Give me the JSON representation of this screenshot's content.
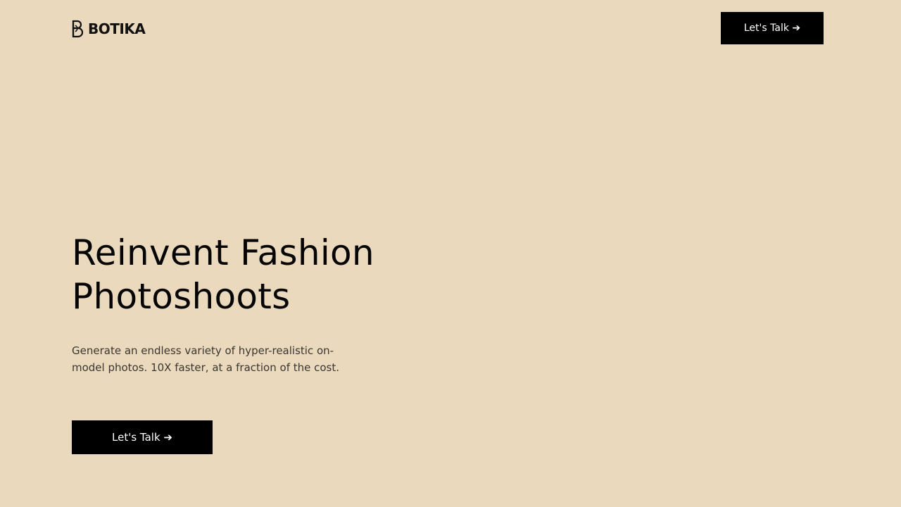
{
  "header": {
    "brand": "BOTIKA",
    "logo_icon": "botika-b-logo-icon",
    "cta_label": "Let's Talk ➔"
  },
  "hero": {
    "title_line1": "Reinvent Fashion",
    "title_line2": "Photoshoots",
    "subtitle": "Generate an endless variety of hyper-realistic on-model photos. 10X faster, at a fraction of the cost.",
    "cta_label": "Let's Talk ➔"
  },
  "colors": {
    "background": "#ebd9bd",
    "button_bg": "#000000",
    "button_text": "#ffffff"
  }
}
